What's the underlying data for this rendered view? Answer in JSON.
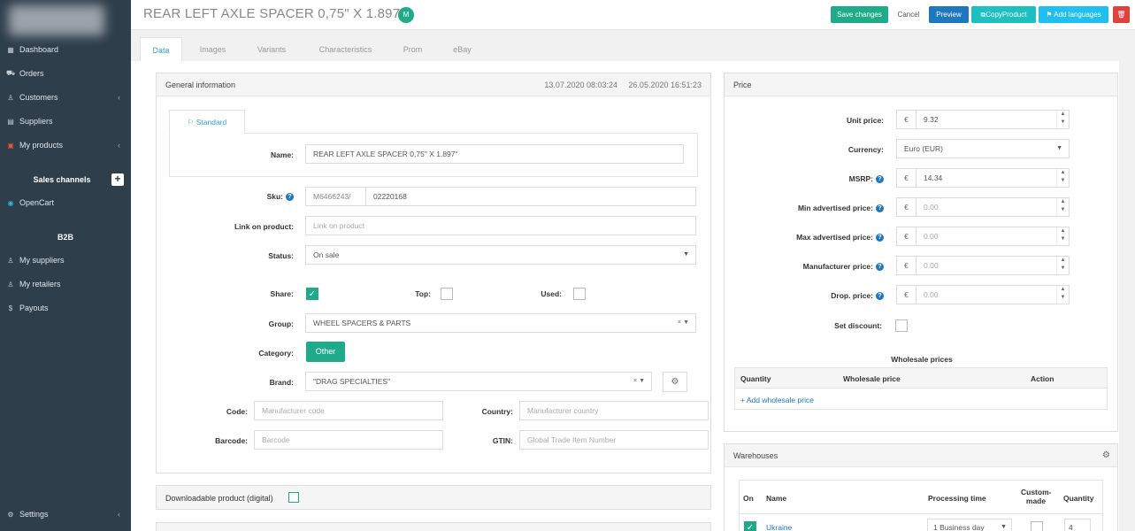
{
  "sidebar": {
    "items": [
      {
        "label": "Dashboard",
        "icon": "grid-icon",
        "glyph": "▦",
        "chev": ""
      },
      {
        "label": "Orders",
        "icon": "cart-icon",
        "glyph": "⛟",
        "chev": ""
      },
      {
        "label": "Customers",
        "icon": "user-icon",
        "glyph": "♙",
        "chev": "‹"
      },
      {
        "label": "Suppliers",
        "icon": "list-icon",
        "glyph": "▤",
        "chev": ""
      },
      {
        "label": "My products",
        "icon": "box-icon",
        "glyph": "▣",
        "chev": "‹"
      }
    ],
    "sales_channels_label": "Sales channels",
    "opencart_label": "OpenCart",
    "b2b_label": "B2B",
    "b2b_items": [
      {
        "label": "My suppliers",
        "icon": "user-icon",
        "glyph": "♙"
      },
      {
        "label": "My retailers",
        "icon": "user-icon",
        "glyph": "♙"
      },
      {
        "label": "Payouts",
        "icon": "dollar-icon",
        "glyph": "$"
      }
    ],
    "settings_label": "Settings"
  },
  "header": {
    "title": "REAR LEFT AXLE SPACER 0,75\" X 1.897\"",
    "badge": "M",
    "buttons": {
      "save": "Save changes",
      "cancel": "Cancel",
      "preview": "Preview",
      "copy": "CopyProduct",
      "languages": "Add languages"
    }
  },
  "tabs": [
    "Data",
    "Images",
    "Variants",
    "Characteristics",
    "Prom",
    "eBay"
  ],
  "general": {
    "title": "General information",
    "created": "13.07.2020 08:03:24",
    "modified": "26.05.2020 16:51:23",
    "lang_tab": "Standard",
    "name_label": "Name:",
    "name_value": "REAR LEFT AXLE SPACER 0,75\" X 1.897\"",
    "sku_label": "Sku:",
    "sku_prefix": "M6466243/",
    "sku_value": "02220168",
    "link_label": "Link on product:",
    "link_placeholder": "Link on product",
    "status_label": "Status:",
    "status_value": "On sale",
    "share_label": "Share:",
    "top_label": "Top:",
    "used_label": "Used:",
    "group_label": "Group:",
    "group_value": "WHEEL SPACERS & PARTS",
    "category_label": "Category:",
    "category_value": "Other",
    "brand_label": "Brand:",
    "brand_value": "\"DRAG SPECIALTIES\"",
    "code_label": "Code:",
    "code_placeholder": "Manufacturer code",
    "country_label": "Country:",
    "country_placeholder": "Manufacturer country",
    "barcode_label": "Barcode:",
    "barcode_placeholder": "Barcode",
    "gtin_label": "GTIN:",
    "gtin_placeholder": "Global Trade Item Number",
    "clear_mark": "×"
  },
  "downloadable": {
    "label": "Downloadable product (digital)"
  },
  "price": {
    "title": "Price",
    "currency_symbol": "€",
    "rows": [
      {
        "label": "Unit price:",
        "value": "9.32",
        "help": false
      },
      {
        "label": "MSRP:",
        "value": "14.34",
        "help": true
      },
      {
        "label": "Min advertised price:",
        "value": "0.00",
        "help": true
      },
      {
        "label": "Max advertised price:",
        "value": "0.00",
        "help": true
      },
      {
        "label": "Manufacturer price:",
        "value": "0.00",
        "help": true
      },
      {
        "label": "Drop. price:",
        "value": "0.00",
        "help": true
      }
    ],
    "currency_label": "Currency:",
    "currency_value": "Euro (EUR)",
    "discount_label": "Set discount:",
    "wholesale_title": "Wholesale prices",
    "wholesale_cols": [
      "Quantity",
      "Wholesale price",
      "Action"
    ],
    "add_wholesale": "+ Add wholesale price"
  },
  "warehouses": {
    "title": "Warehouses",
    "cols": [
      "On",
      "Name",
      "Processing time",
      "Custom-made",
      "Quantity"
    ],
    "row": {
      "name": "Ukraine",
      "processing": "1 Business day",
      "quantity": "4"
    }
  }
}
